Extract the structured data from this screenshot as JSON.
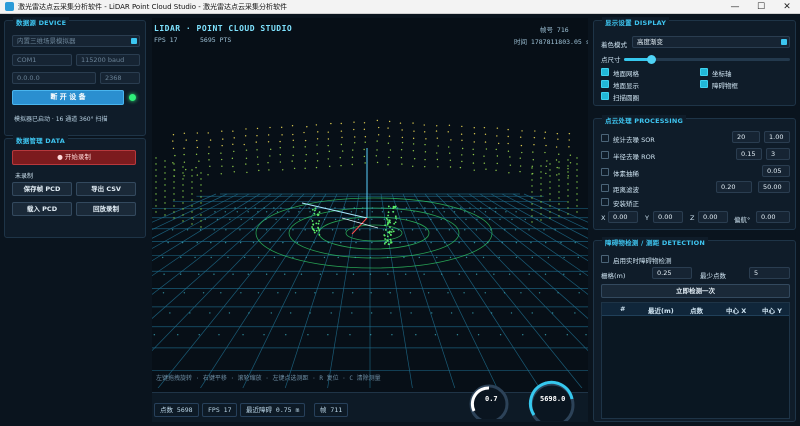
{
  "window": {
    "title": "激光雷达点云采集分析软件 - LiDAR Point Cloud Studio - 激光雷达点云采集分析软件",
    "min": "—",
    "max": "☐",
    "close": "✕"
  },
  "device": {
    "title": "数据源  DEVICE",
    "source_placeholder": "内置三维场景模拟器",
    "port_placeholder": "COM1",
    "baud_placeholder": "115200 baud",
    "ip_placeholder": "0.0.0.0",
    "udp_port_placeholder": "2368",
    "open_button": "断 开 设 备",
    "status_text": "模拟器已启动 · 16 通道 360° 扫描"
  },
  "data": {
    "title": "数据管理  DATA",
    "record_button": "● 开始录制",
    "record_status": "未录制",
    "save_frame": "保存帧 PCD",
    "export_csv": "导出 CSV",
    "load_pcd": "载入 PCD",
    "playback": "回放录制"
  },
  "viewport": {
    "title": "LIDAR · POINT CLOUD STUDIO",
    "fps": "FPS 17",
    "pts": "5695 PTS",
    "frame": "帧号  716",
    "time": "时间  1787811803.05 s",
    "hint": "左键拖拽旋转 · 右键平移 · 滚轮缩放 · 左键点选测距 · R 复位 · C 清除测量",
    "stat_points": "点数  5698",
    "stat_fps": "FPS  17",
    "stat_nearest": "最近障碍  0.75 m",
    "stat_frame": "帧  711",
    "gauge1": "0.7",
    "gauge2": "5698.0"
  },
  "display": {
    "title": "显示设置  DISPLAY",
    "color_mode_label": "着色模式",
    "color_mode_value": "高度渐变",
    "point_size_label": "点尺寸",
    "point_size_level": 0.16,
    "ground_grid": "地面网格",
    "axes": "坐标轴",
    "ground_show": "地面显示",
    "obstacle_box": "障碍物框",
    "scan_circle": "扫描圆圈"
  },
  "processing": {
    "title": "点云处理  PROCESSING",
    "sor": "统计去噪 SOR",
    "sor_k": "20",
    "sor_std": "1.00",
    "ror": "半径去噪 ROR",
    "ror_r": "0.15",
    "ror_n": "3",
    "voxel": "体素抽稀",
    "voxel_v": "0.05",
    "range": "距离滤波",
    "range_min": "0.20",
    "range_max": "50.00",
    "install": "安装矫正",
    "x_label": "X",
    "x_val": "0.00",
    "y_label": "Y",
    "y_val": "0.00",
    "z_label": "Z",
    "z_val": "0.00",
    "yaw_label": "偏航°",
    "yaw_val": "0.00"
  },
  "detection": {
    "title": "障碍物检测 / 测距  DETECTION",
    "realtime": "启用实时障碍物检测",
    "eps_label": "栅格(m)",
    "eps_val": "0.25",
    "min_label": "最少点数",
    "min_val": "5",
    "detect_button": "立即检测一次",
    "col_no": "#",
    "col_dist": "最近(m)",
    "col_pts": "点数",
    "col_cx": "中心 X",
    "col_cy": "中心 Y"
  },
  "colors": {
    "accent": "#3ec4ef",
    "danger": "#7c1b1e",
    "primary": "#2a8fd0"
  }
}
